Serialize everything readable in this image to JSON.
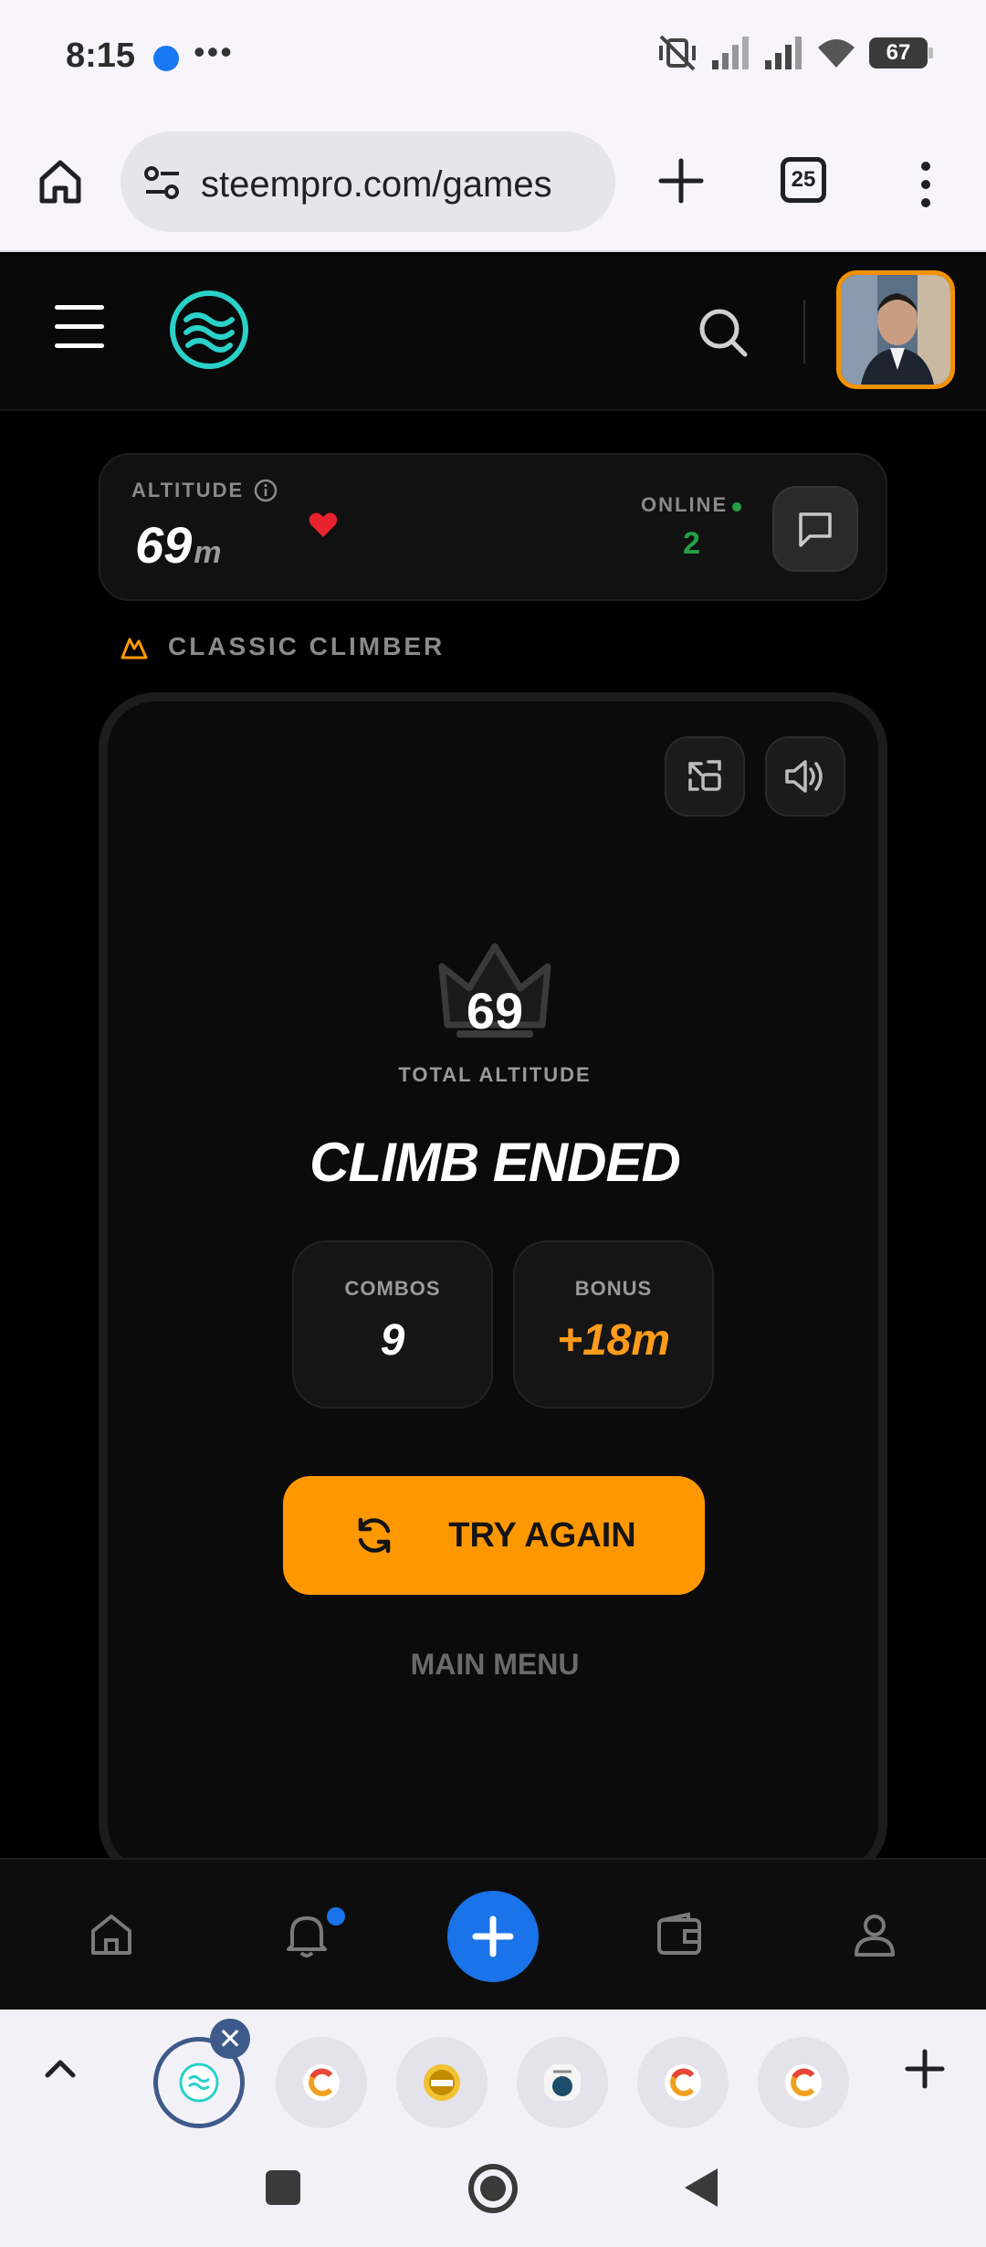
{
  "status_bar": {
    "time": "8:15",
    "more": "•••",
    "battery": "67"
  },
  "browser": {
    "url": "steempro.com/games",
    "tab_count": "25"
  },
  "altitude_card": {
    "label": "ALTITUDE",
    "value": "69",
    "unit": "m",
    "online_label": "ONLINE",
    "online_count": "2"
  },
  "game_mode": "CLASSIC CLIMBER",
  "result": {
    "score": "69",
    "total_label": "TOTAL ALTITUDE",
    "title": "CLIMB ENDED",
    "combos_label": "COMBOS",
    "combos_value": "9",
    "bonus_label": "BONUS",
    "bonus_value": "+18m",
    "try_again": "TRY AGAIN",
    "main_menu": "MAIN MENU"
  },
  "bottom_nav": {
    "items": [
      "home-icon",
      "bell-icon",
      "plus-icon",
      "wallet-icon",
      "user-icon"
    ]
  },
  "tab_strip": {
    "tabs": [
      "steempro-favicon",
      "favicon-c",
      "steem-coin-favicon",
      "photo-favicon",
      "favicon-c",
      "favicon-c"
    ]
  },
  "colors": {
    "accent_orange": "#ff9800",
    "accent_blue": "#1a73e8",
    "online_green": "#23a047",
    "logo_teal": "#2ad1c9"
  }
}
